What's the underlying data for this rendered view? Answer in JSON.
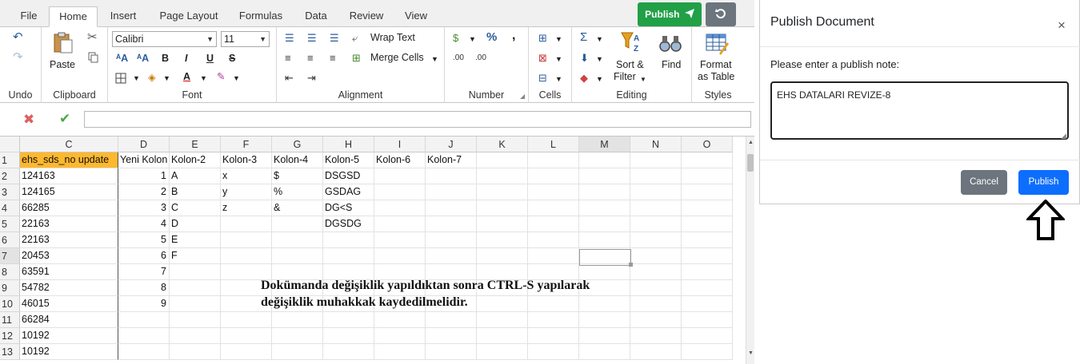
{
  "tabs": [
    "File",
    "Home",
    "Insert",
    "Page Layout",
    "Formulas",
    "Data",
    "Review",
    "View"
  ],
  "top_actions": {
    "publish_label": "Publish",
    "publish_color": "#21a047",
    "refresh_color": "#6c757d"
  },
  "ribbon": {
    "groups": {
      "undo": "Undo",
      "clipboard": "Clipboard",
      "font": "Font",
      "alignment": "Alignment",
      "number": "Number",
      "cells": "Cells",
      "editing": "Editing",
      "styles": "Styles"
    },
    "paste_label": "Paste",
    "font_name": "Calibri",
    "font_size": "11",
    "wrap_text": "Wrap Text",
    "merge_cells": "Merge Cells",
    "percent": "%",
    "comma": ",",
    "sort_filter_line1": "Sort &",
    "sort_filter_line2": "Filter",
    "find": "Find",
    "format_table_line1": "Format",
    "format_table_line2": "as Table"
  },
  "grid": {
    "columns": [
      "C",
      "D",
      "E",
      "F",
      "G",
      "H",
      "I",
      "J",
      "K",
      "L",
      "M",
      "N",
      "O"
    ],
    "selected_column": "M",
    "selected_row": "7",
    "rows": [
      {
        "num": "1",
        "C": "ehs_sds_no update",
        "D": "Yeni Kolon",
        "E": "Kolon-2",
        "F": "Kolon-3",
        "G": "Kolon-4",
        "H": "Kolon-5",
        "I": "Kolon-6",
        "J": "Kolon-7"
      },
      {
        "num": "2",
        "C": "124163",
        "D": "1",
        "E": "A",
        "F": "x",
        "G": "$",
        "H": "DSGSD"
      },
      {
        "num": "3",
        "C": "124165",
        "D": "2",
        "E": "B",
        "F": "y",
        "G": "%",
        "H": "GSDAG"
      },
      {
        "num": "4",
        "C": "66285",
        "D": "3",
        "E": "C",
        "F": "z",
        "G": "&",
        "H": "DG<S"
      },
      {
        "num": "5",
        "C": "22163",
        "D": "4",
        "E": "D",
        "H": "DGSDG"
      },
      {
        "num": "6",
        "C": "22163",
        "D": "5",
        "E": "E"
      },
      {
        "num": "7",
        "C": "20453",
        "D": "6",
        "E": "F"
      },
      {
        "num": "8",
        "C": "63591",
        "D": "7"
      },
      {
        "num": "9",
        "C": "54782",
        "D": "8"
      },
      {
        "num": "10",
        "C": "46015",
        "D": "9"
      },
      {
        "num": "11",
        "C": "66284"
      },
      {
        "num": "12",
        "C": "10192"
      },
      {
        "num": "13",
        "C": "10192"
      }
    ],
    "highlight_color": "#fdb82f",
    "note_line1": "Dokümanda değişiklik yapıldıktan sonra CTRL-S yapılarak",
    "note_line2": "değişiklik muhakkak kaydedilmelidir."
  },
  "modal": {
    "title": "Publish Document",
    "close": "×",
    "prompt": "Please enter a publish note:",
    "note_value": "EHS DATALARI REVIZE-8",
    "cancel_label": "Cancel",
    "publish_label": "Publish",
    "publish_color": "#0d6efd",
    "cancel_color": "#6c757d"
  }
}
